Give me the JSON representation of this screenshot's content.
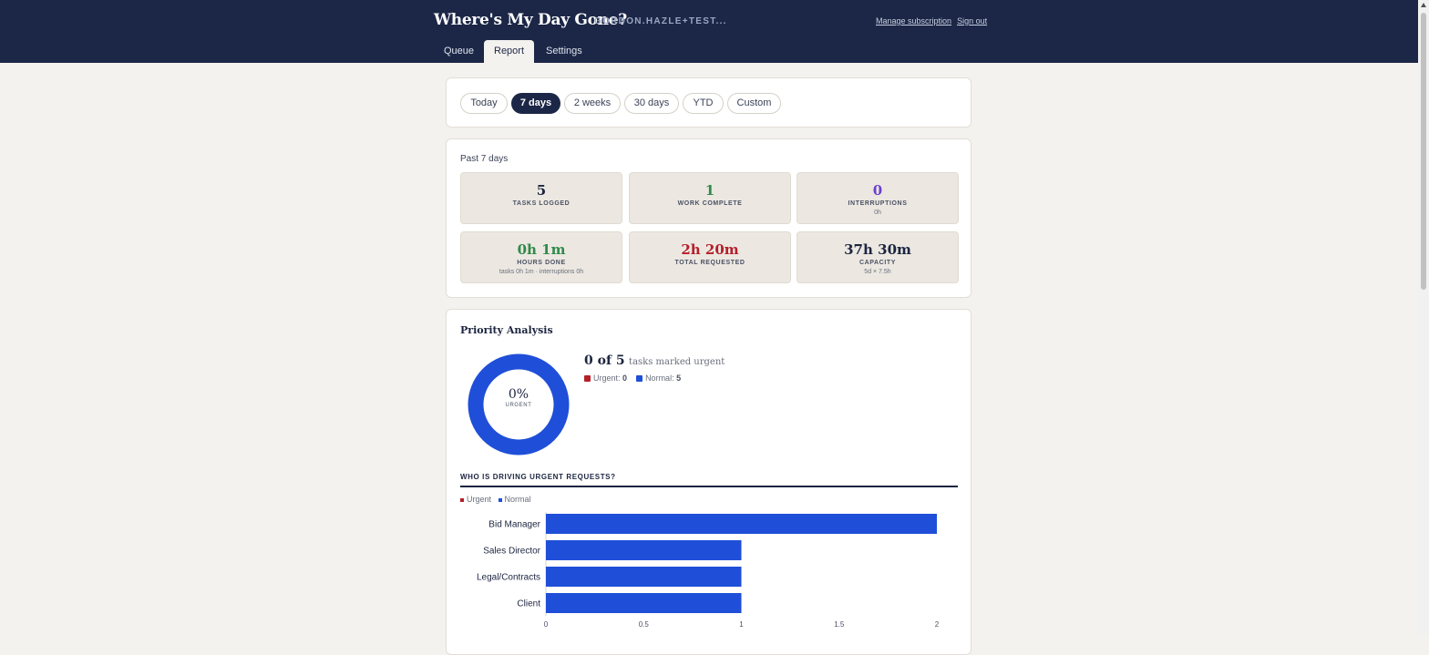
{
  "header": {
    "app_title": "Where's My Day Gone?",
    "user_email": "GORDON.HAZLE+TEST...",
    "manage_subscription": "Manage subscription",
    "sign_out": "Sign out",
    "tabs": [
      {
        "label": "Queue",
        "active": false
      },
      {
        "label": "Report",
        "active": true
      },
      {
        "label": "Settings",
        "active": false
      }
    ]
  },
  "range_filter": {
    "options": [
      "Today",
      "7 days",
      "2 weeks",
      "30 days",
      "YTD",
      "Custom"
    ],
    "selected": "7 days"
  },
  "summary": {
    "period_label": "Past 7 days",
    "stats": [
      {
        "value": "5",
        "label": "TASKS LOGGED",
        "sub": "",
        "color": "#1c2540"
      },
      {
        "value": "1",
        "label": "WORK COMPLETE",
        "sub": "",
        "color": "#2f8a4a"
      },
      {
        "value": "0",
        "label": "INTERRUPTIONS",
        "sub": "0h",
        "color": "#6b3fd1"
      },
      {
        "value": "0h 1m",
        "label": "HOURS DONE",
        "sub": "tasks 0h 1m · interruptions 0h",
        "color": "#2f8a4a"
      },
      {
        "value": "2h 20m",
        "label": "TOTAL REQUESTED",
        "sub": "",
        "color": "#b51f2a"
      },
      {
        "value": "37h 30m",
        "label": "CAPACITY",
        "sub": "5d × 7.5h",
        "color": "#1c2540"
      }
    ]
  },
  "priority": {
    "title": "Priority Analysis",
    "donut_pct": "0%",
    "donut_label": "URGENT",
    "urgent_summary": "0 of 5",
    "urgent_summary_suffix": "tasks marked urgent",
    "urgent_label": "Urgent:",
    "urgent_count": "0",
    "normal_label": "Normal:",
    "normal_count": "5",
    "urgent_fraction": 0,
    "colors": {
      "urgent": "#b51f2a",
      "normal": "#1f4fd8"
    }
  },
  "chart_heading": "WHO IS DRIVING URGENT REQUESTS?",
  "chart_data": {
    "type": "bar",
    "orientation": "horizontal",
    "stacked": true,
    "categories": [
      "Bid Manager",
      "Sales Director",
      "Legal/Contracts",
      "Client"
    ],
    "series": [
      {
        "name": "Urgent",
        "values": [
          0,
          0,
          0,
          0
        ],
        "color": "#b51f2a"
      },
      {
        "name": "Normal",
        "values": [
          2,
          1,
          1,
          1
        ],
        "color": "#1f4fd8"
      }
    ],
    "xlim": [
      0,
      2
    ],
    "xticks": [
      "0",
      "0.5",
      "1",
      "1.5",
      "2"
    ],
    "legend": "top-left"
  }
}
